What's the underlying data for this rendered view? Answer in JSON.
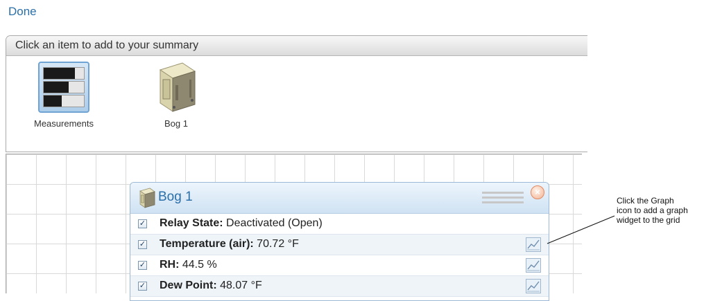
{
  "header": {
    "done_label": "Done"
  },
  "picker": {
    "title": "Click an item to add to your summary",
    "items": [
      {
        "label": "Measurements",
        "icon": "measurements-icon"
      },
      {
        "label": "Bog 1",
        "icon": "bog-device-icon"
      }
    ]
  },
  "widget": {
    "title": "Bog 1",
    "rows": [
      {
        "label": "Relay State:",
        "value": " Deactivated (Open)",
        "checked": true,
        "graph": false
      },
      {
        "label": "Temperature (air):",
        "value": "  70.72 °F",
        "checked": true,
        "graph": true
      },
      {
        "label": "RH:",
        "value": "  44.5 %",
        "checked": true,
        "graph": true
      },
      {
        "label": "Dew Point:",
        "value": "  48.07 °F",
        "checked": true,
        "graph": true
      }
    ]
  },
  "annotation": {
    "lines": [
      "Click the Graph",
      "icon to add a graph",
      "widget to the grid"
    ]
  },
  "colors": {
    "link": "#2b6fa8",
    "widget_header": "#cfe2f3",
    "close_button": "#f3b394"
  }
}
